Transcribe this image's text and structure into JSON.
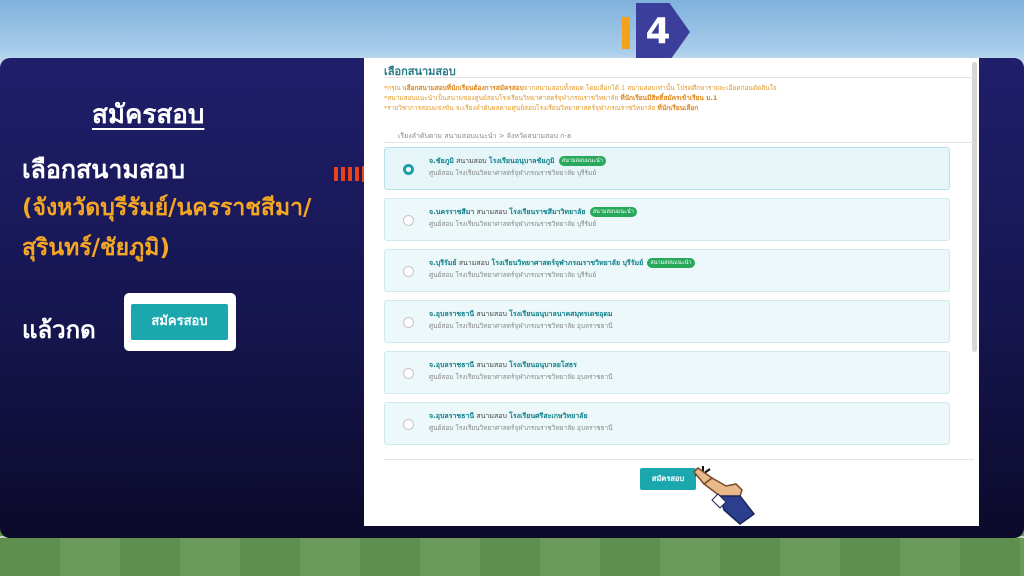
{
  "step": {
    "number": "4"
  },
  "left": {
    "title": "สมัครสอบ",
    "instruction": "เลือกสนามสอบ",
    "provinces": "(จังหวัดบุรีรัมย์/นครราชสีมา/สุรินทร์/ชัยภูมิ)",
    "then_label": "แล้วกด",
    "demo_button": "สมัครสอบ"
  },
  "form": {
    "title": "เลือกสนามสอบ",
    "notes": [
      {
        "pre": "*กรุณา",
        "bold": "เลือกสนามสอบที่นักเรียนต้องการสมัครสอบ",
        "post": "จากสนามสอบทั้งหมด โดยเลือกได้ 1 สนามสอบเท่านั้น โปรดศึกษารายละเอียดก่อนตัดสินใจ"
      },
      {
        "pre": "*สนามสอบแนะนำเป็นสนามของศูนย์สอบโรงเรียนวิทยาศาสตร์จุฬาภรณราชวิทยาลัย ",
        "bold": "ที่นักเรียนมีสิทธิ์สมัครเข้าเรียน ม.1",
        "post": ""
      },
      {
        "pre": "*รายวิชาการสอบแข่งขัน จะเรียงลำดับผลตามศูนย์สอบโรงเรียนวิทยาศาสตร์จุฬาภรณราชวิทยาลัย ",
        "bold": "ที่นักเรียนเลือก",
        "post": ""
      }
    ],
    "breadcrumb": "เรียงลำดับตาม สนามสอบแนะนำ > จังหวัดสนามสอบ ก-ฮ",
    "schools": [
      {
        "province": "จ.ชัยภูมิ",
        "venue_label": "สนามสอบ",
        "venue_name": "โรงเรียนอนุบาลชัยภูมิ",
        "badge": "สนามสอบแนะนำ",
        "center": "ศูนย์สอบ โรงเรียนวิทยาศาสตร์จุฬาภรณราชวิทยาลัย บุรีรัมย์",
        "selected": true
      },
      {
        "province": "จ.นครราชสีมา",
        "venue_label": "สนามสอบ",
        "venue_name": "โรงเรียนราชสีมาวิทยาลัย",
        "badge": "สนามสอบแนะนำ",
        "center": "ศูนย์สอบ โรงเรียนวิทยาศาสตร์จุฬาภรณราชวิทยาลัย บุรีรัมย์",
        "selected": false
      },
      {
        "province": "จ.บุรีรัมย์",
        "venue_label": "สนามสอบ",
        "venue_name": "โรงเรียนวิทยาศาสตร์จุฬาภรณราชวิทยาลัย บุรีรัมย์",
        "badge": "สนามสอบแนะนำ",
        "center": "ศูนย์สอบ โรงเรียนวิทยาศาสตร์จุฬาภรณราชวิทยาลัย บุรีรัมย์",
        "selected": false
      },
      {
        "province": "จ.อุบลราชธานี",
        "venue_label": "สนามสอบ",
        "venue_name": "โรงเรียนอนุบาลนาคสมุทรเดชอุดม",
        "badge": "",
        "center": "ศูนย์สอบ โรงเรียนวิทยาศาสตร์จุฬาภรณราชวิทยาลัย อุบลราชธานี",
        "selected": false
      },
      {
        "province": "จ.อุบลราชธานี",
        "venue_label": "สนามสอบ",
        "venue_name": "โรงเรียนอนุบาลยโสธร",
        "badge": "",
        "center": "ศูนย์สอบ โรงเรียนวิทยาศาสตร์จุฬาภรณราชวิทยาลัย อุบลราชธานี",
        "selected": false
      },
      {
        "province": "จ.อุบลราชธานี",
        "venue_label": "สนามสอบ",
        "venue_name": "โรงเรียนศรีสะเกษวิทยาลัย",
        "badge": "",
        "center": "ศูนย์สอบ โรงเรียนวิทยาศาสตร์จุฬาภรณราชวิทยาลัย อุบลราชธานี",
        "selected": false
      }
    ],
    "submit_label": "สมัครสอบ"
  },
  "colors": {
    "accent_teal": "#1aa7ae",
    "panel_navy": "#1f1f6b",
    "highlight_orange": "#f5a623",
    "arrow_red": "#f1461d",
    "badge_green": "#27a85a"
  },
  "icons": {
    "arrow": "arrow-right-icon",
    "hand": "pointing-hand-icon",
    "radio": "radio-icon"
  }
}
